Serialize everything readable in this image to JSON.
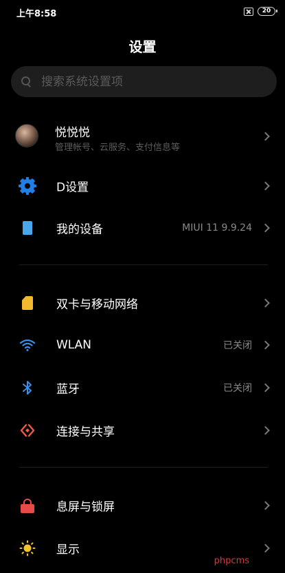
{
  "status_bar": {
    "time": "上午8:58",
    "battery": "20"
  },
  "header": {
    "title": "设置"
  },
  "search": {
    "placeholder": "搜索系统设置项"
  },
  "profile": {
    "name": "悦悦悦",
    "subtitle": "管理帐号、云服务、支付信息等"
  },
  "items": [
    {
      "label": "D设置",
      "value": "",
      "icon": "gear-icon",
      "color": "#1f7fe6"
    },
    {
      "label": "我的设备",
      "value": "MIUI 11 9.9.24",
      "icon": "device-icon",
      "color": "#4aa6e8"
    },
    {
      "label": "双卡与移动网络",
      "value": "",
      "icon": "sim-card-icon",
      "color": "#f2b92e"
    },
    {
      "label": "WLAN",
      "value": "已关闭",
      "icon": "wifi-icon",
      "color": "#3a8fe8"
    },
    {
      "label": "蓝牙",
      "value": "已关闭",
      "icon": "bluetooth-icon",
      "color": "#3a8fe8"
    },
    {
      "label": "连接与共享",
      "value": "",
      "icon": "share-connection-icon",
      "color": "#ef5a4a"
    },
    {
      "label": "息屏与锁屏",
      "value": "",
      "icon": "lock-icon",
      "color": "#e84a4a"
    },
    {
      "label": "显示",
      "value": "",
      "icon": "sun-icon",
      "color": "#f2c12e"
    }
  ],
  "watermark": "phpcms"
}
